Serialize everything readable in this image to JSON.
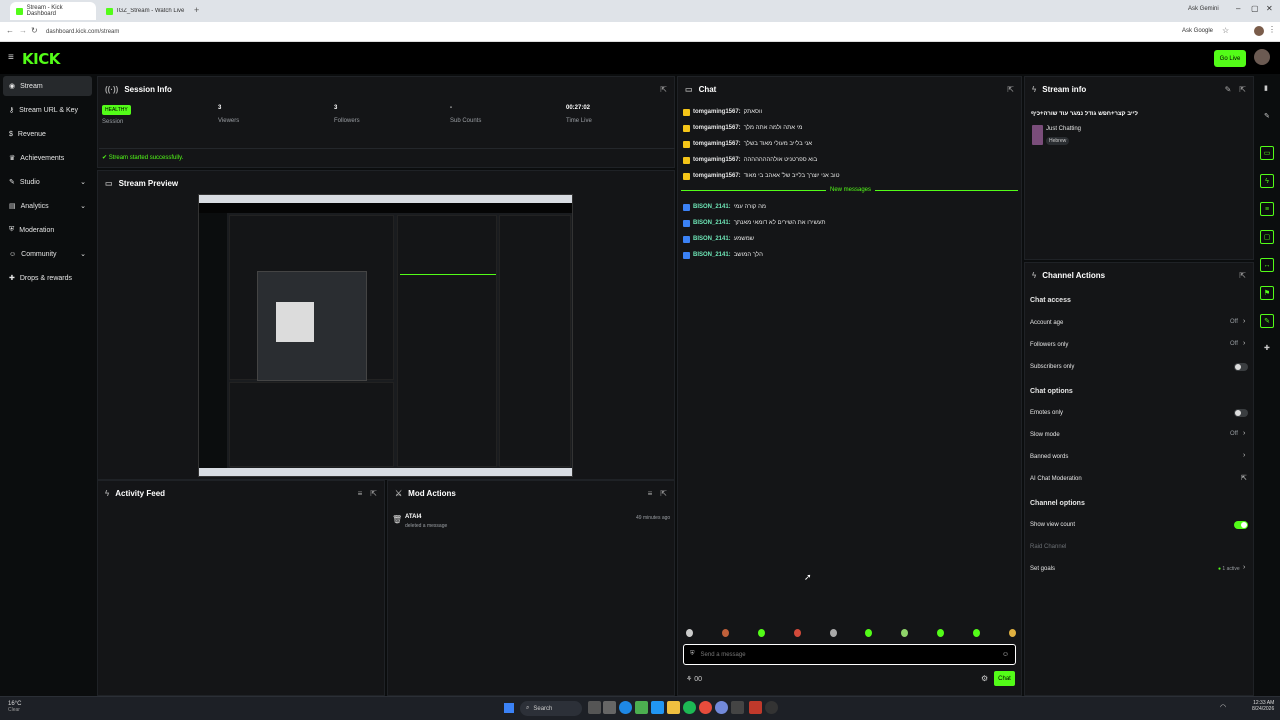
{
  "browser": {
    "tabs": [
      {
        "label": "Stream - Kick Dashboard"
      },
      {
        "label": "IGZ_Stream - Watch Live on Ki..."
      }
    ],
    "new_tab_icon": "plus-icon",
    "url": "dashboard.kick.com/stream",
    "ask_label": "Ask Google",
    "gemini_label": "Ask Gemini"
  },
  "header": {
    "logo_text": "KICK",
    "go_live_label": "Go Live"
  },
  "sidebar": {
    "items": [
      {
        "label": "Stream",
        "icon": "broadcast-icon",
        "active": true
      },
      {
        "label": "Stream URL & Key",
        "icon": "key-icon"
      },
      {
        "label": "Revenue",
        "icon": "dollar-icon"
      },
      {
        "label": "Achievements",
        "icon": "trophy-icon"
      },
      {
        "label": "Studio",
        "icon": "studio-icon",
        "chevron": true
      },
      {
        "label": "Analytics",
        "icon": "chart-icon",
        "chevron": true
      },
      {
        "label": "Moderation",
        "icon": "shield-icon"
      },
      {
        "label": "Community",
        "icon": "people-icon",
        "chevron": true
      },
      {
        "label": "Drops & rewards",
        "icon": "gift-icon"
      }
    ]
  },
  "session": {
    "title": "Session Info",
    "health_badge": "HEALTHY",
    "health_label": "Session",
    "viewers_value": "3",
    "viewers_label": "Viewers",
    "followers_value": "3",
    "followers_label": "Followers",
    "subs_value": "-",
    "subs_label": "Sub Counts",
    "time_value": "00:27:02",
    "time_label": "Time Live",
    "status_message": "Stream started successfully."
  },
  "preview": {
    "title": "Stream Preview"
  },
  "activity": {
    "title": "Activity Feed"
  },
  "mod_actions": {
    "title": "Mod Actions",
    "entries": [
      {
        "user": "ATAI4",
        "action": "deleted a message",
        "time": "49 minutes ago"
      }
    ]
  },
  "chat": {
    "title": "Chat",
    "messages": [
      {
        "user": "tomgaming1567:",
        "text": "ווסאתק"
      },
      {
        "user": "tomgaming1567:",
        "text": "מי אתה ולמה אתה מלך"
      },
      {
        "user": "tomgaming1567:",
        "text": "אני בלייב מעולי מאוד בשלך"
      },
      {
        "user": "tomgaming1567:",
        "text": "בוא ספרטניט אולהההההההה"
      },
      {
        "user": "tomgaming1567:",
        "text": "טוב אני יוצרך בלייב של' אאהב בי מאוד"
      }
    ],
    "new_messages_label": "New messages",
    "new_messages": [
      {
        "user": "BISON_2141:",
        "text": "מה קורה עמי"
      },
      {
        "user": "BISON_2141:",
        "text": "תעשירו את השירים לא דומאי מאנתך"
      },
      {
        "user": "BISON_2141:",
        "text": "שמשמע"
      },
      {
        "user": "BISON_2141:",
        "text": "הלך המושב"
      }
    ],
    "input_placeholder": "Send a message",
    "points_value": "00",
    "send_label": "Chat"
  },
  "stream_info": {
    "title": "Stream info",
    "stream_title": "לייב קצר+חפש גודל נמגר עוד שורה+כיף כיף כיף",
    "category": "Just Chatting",
    "tag": "Hebrew"
  },
  "channel_actions": {
    "title": "Channel Actions",
    "chat_access_header": "Chat access",
    "account_age_label": "Account age",
    "account_age_value": "Off",
    "followers_only_label": "Followers only",
    "followers_only_value": "Off",
    "subscribers_only_label": "Subscribers only",
    "chat_options_header": "Chat options",
    "emotes_only_label": "Emotes only",
    "slow_mode_label": "Slow mode",
    "slow_mode_value": "Off",
    "banned_words_label": "Banned words",
    "ai_mod_label": "AI Chat Moderation",
    "channel_options_header": "Channel options",
    "show_view_count_label": "Show view count",
    "raid_channel_label": "Raid Channel",
    "set_goals_label": "Set goals",
    "set_goals_value": "1 active"
  },
  "taskbar": {
    "weather_temp": "16°C",
    "weather_desc": "Clear",
    "search_label": "Search",
    "time": "12:33 AM",
    "date": "8/24/2026"
  },
  "colors": {
    "accent": "#53fc18",
    "panel": "#141517",
    "background": "#0b0d0e"
  }
}
